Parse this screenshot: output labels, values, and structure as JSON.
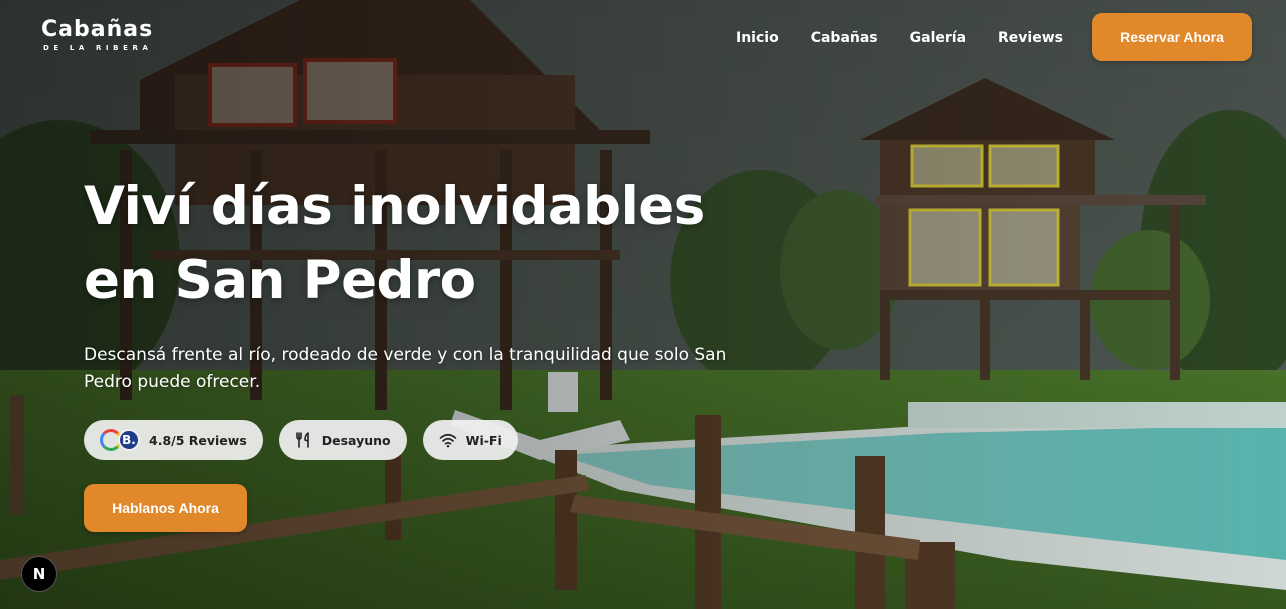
{
  "brand": {
    "name": "Cabañas",
    "tagline": "DE LA RIBERA"
  },
  "nav": {
    "items": [
      {
        "label": "Inicio"
      },
      {
        "label": "Cabañas"
      },
      {
        "label": "Galería"
      },
      {
        "label": "Reviews"
      }
    ],
    "cta_label": "Reservar Ahora"
  },
  "hero": {
    "title_line1": "Viví días inolvidables",
    "title_line2": "en San Pedro",
    "subtitle": "Descansá frente al río, rodeado de verde y con la tranquilidad que solo San Pedro puede ofrecer.",
    "features": [
      {
        "icon": "google-booking-icon",
        "label": "4.8/5 Reviews",
        "badge_letter": "B."
      },
      {
        "icon": "fork-knife-icon",
        "label": "Desayuno"
      },
      {
        "icon": "wifi-icon",
        "label": "Wi-Fi"
      }
    ],
    "cta_label": "Hablanos Ahora"
  },
  "dev_badge": {
    "letter": "N"
  },
  "colors": {
    "accent": "#e0882a",
    "chip_bg": "#f0f0f0",
    "text_light": "#ffffff"
  }
}
